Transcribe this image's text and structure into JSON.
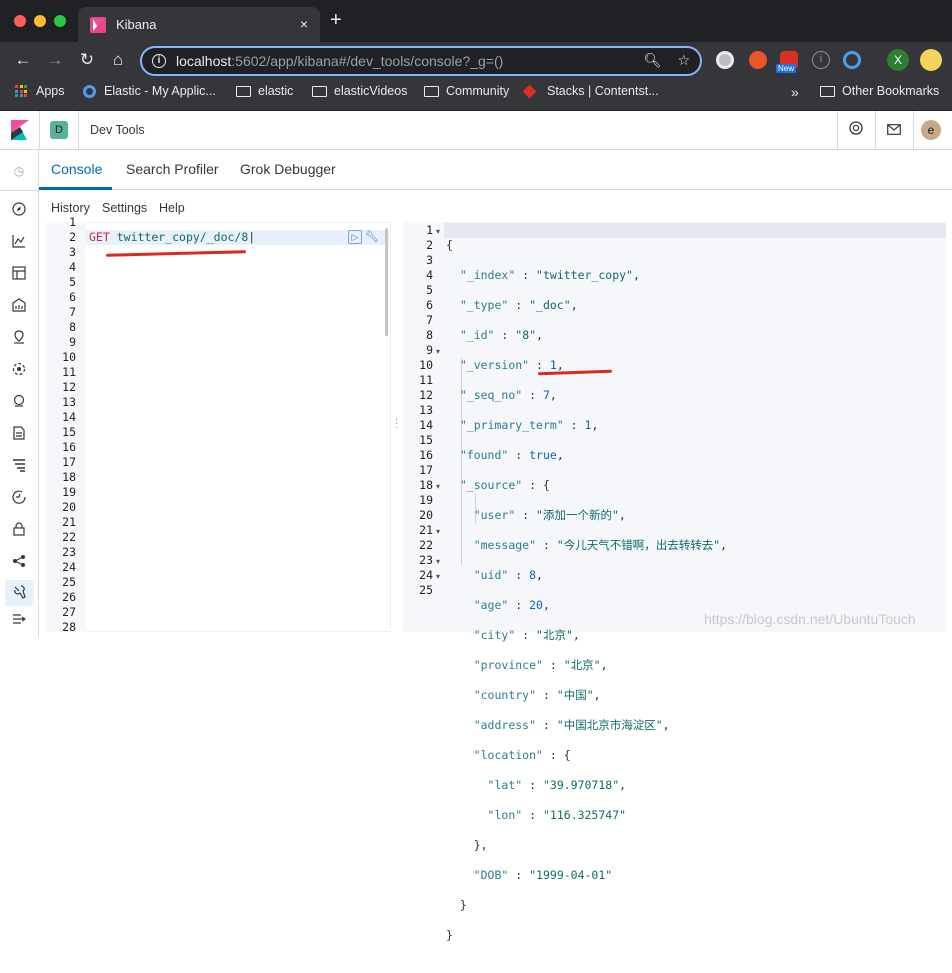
{
  "browser": {
    "tab_title": "Kibana",
    "tab_close": "×",
    "new_tab": "+",
    "url_host": "localhost",
    "url_rest": ":5602/app/kibana#/dev_tools/console?_g=()",
    "ext_new_badge": "New",
    "ext_x_label": "X",
    "bookmarks": {
      "apps": "Apps",
      "elastic_app": "Elastic - My Applic...",
      "elastic": "elastic",
      "elastic_videos": "elasticVideos",
      "community": "Community",
      "stacks": "Stacks | Contentst...",
      "more": "»",
      "other": "Other Bookmarks"
    }
  },
  "kibana": {
    "space_badge": "D",
    "breadcrumb": "Dev Tools",
    "avatar": "e",
    "tabs": [
      "Console",
      "Search Profiler",
      "Grok Debugger"
    ],
    "submenu": [
      "History",
      "Settings",
      "Help"
    ],
    "request": {
      "method": "GET",
      "path": "twitter_copy/_doc/8"
    },
    "left_lines": [
      "1",
      "2",
      "3",
      "4",
      "5",
      "6",
      "7",
      "8",
      "9",
      "10",
      "11",
      "12",
      "13",
      "14",
      "15",
      "16",
      "17",
      "18",
      "19",
      "20",
      "21",
      "22",
      "23",
      "24",
      "25",
      "26",
      "27",
      "28"
    ],
    "right_lines": [
      "1",
      "2",
      "3",
      "4",
      "5",
      "6",
      "7",
      "8",
      "9",
      "10",
      "11",
      "12",
      "13",
      "14",
      "15",
      "16",
      "17",
      "18",
      "19",
      "20",
      "21",
      "22",
      "23",
      "24",
      "25"
    ],
    "response": {
      "_index": "twitter_copy",
      "_type": "_doc",
      "_id": "8",
      "_version": "1",
      "_seq_no": "7",
      "_primary_term": "1",
      "found": "true",
      "user": "添加一个新的",
      "message": "今儿天气不错啊，出去转转去",
      "uid": "8",
      "age": "20",
      "city": "北京",
      "province": "北京",
      "country": "中国",
      "address": "中国北京市海淀区",
      "lat": "39.970718",
      "lon": "116.325747",
      "DOB": "1999-04-01"
    }
  },
  "watermark": "https://blog.csdn.net/UbuntuTouch",
  "colors": {
    "accent": "#006bb4",
    "annotation": "#d92a1f"
  }
}
